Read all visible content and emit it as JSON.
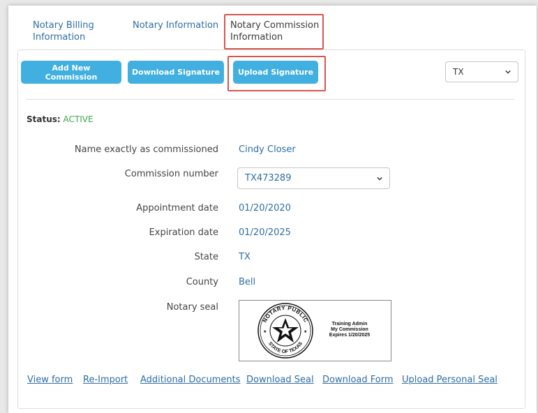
{
  "tabs": [
    {
      "label": "Notary Billing Information"
    },
    {
      "label": "Notary Information"
    },
    {
      "label": "Notary Commission Information"
    }
  ],
  "toolbar": {
    "add_commission": "Add New Commission",
    "download_signature": "Download Signature",
    "upload_signature": "Upload Signature",
    "state_selected": "TX"
  },
  "status": {
    "label": "Status:",
    "value": "ACTIVE"
  },
  "fields": {
    "name_label": "Name exactly as commissioned",
    "name_value": "Cindy Closer",
    "commission_label": "Commission number",
    "commission_value": "TX473289",
    "appointment_label": "Appointment date",
    "appointment_value": "01/20/2020",
    "expiration_label": "Expiration date",
    "expiration_value": "01/20/2025",
    "state_label": "State",
    "state_value": "TX",
    "county_label": "County",
    "county_value": "Bell",
    "seal_label": "Notary seal"
  },
  "seal": {
    "top_text": "NOTARY PUBLIC",
    "bottom_text": "STATE OF TEXAS",
    "line1": "Training Admin",
    "line2": "My Commission",
    "line3": "Expires 1/20/2025"
  },
  "links": {
    "view_form": "View form",
    "reimport": "Re-Import",
    "additional_documents": "Additional Documents",
    "download_seal": "Download Seal",
    "download_form": "Download Form",
    "upload_personal_seal": "Upload Personal Seal"
  },
  "colors": {
    "accent": "#41b0e0",
    "link": "#2e6da4",
    "status_active": "#3aa64a",
    "highlight": "#d9534f"
  }
}
